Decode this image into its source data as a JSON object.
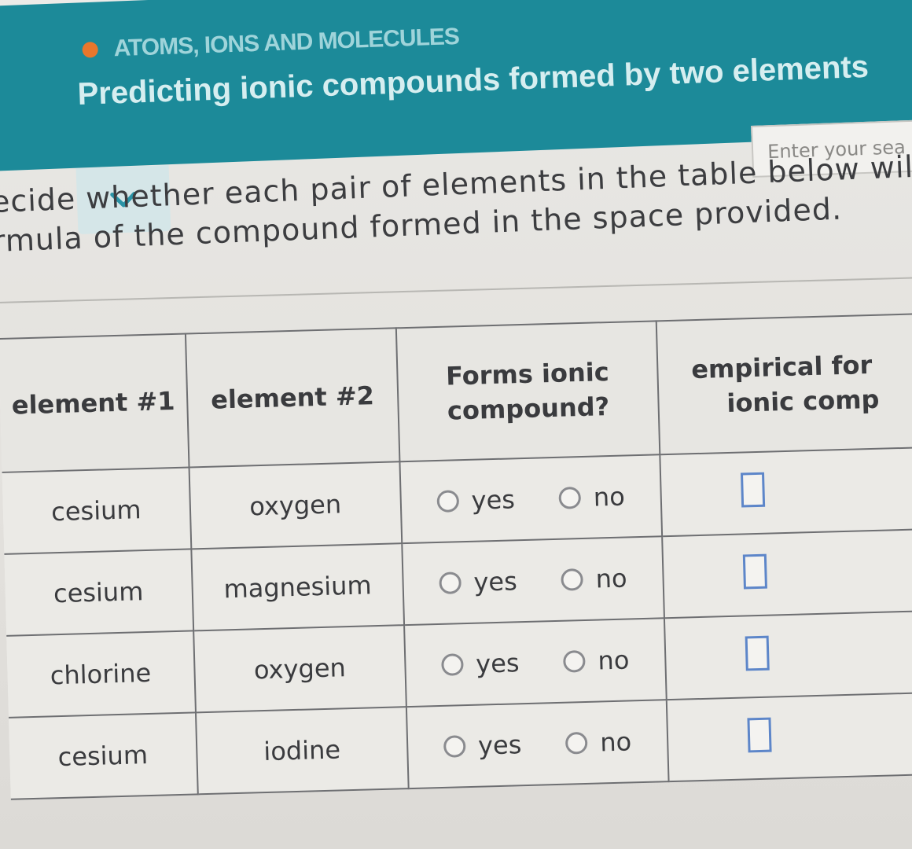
{
  "header": {
    "topic": "ATOMS, IONS AND MOLECULES",
    "title": "Predicting ionic compounds formed by two elements"
  },
  "search": {
    "placeholder": "Enter your sea"
  },
  "instructions": {
    "line1": "ecide whether each pair of elements in the table below wil",
    "line2": "rmula of the compound formed in the space provided."
  },
  "table": {
    "headers": {
      "element1": "element #1",
      "element2": "element #2",
      "forms_ionic_line1": "Forms ionic",
      "forms_ionic_line2": "compound?",
      "formula_line1": "empirical for",
      "formula_line2": "ionic comp"
    },
    "option_yes": "yes",
    "option_no": "no",
    "rows": [
      {
        "element1": "cesium",
        "element2": "oxygen"
      },
      {
        "element1": "cesium",
        "element2": "magnesium"
      },
      {
        "element1": "chlorine",
        "element2": "oxygen"
      },
      {
        "element1": "cesium",
        "element2": "iodine"
      }
    ]
  },
  "colors": {
    "banner": "#1c8a99",
    "topic_dot": "#e8772c",
    "answer_box_border": "#5d86c9"
  }
}
